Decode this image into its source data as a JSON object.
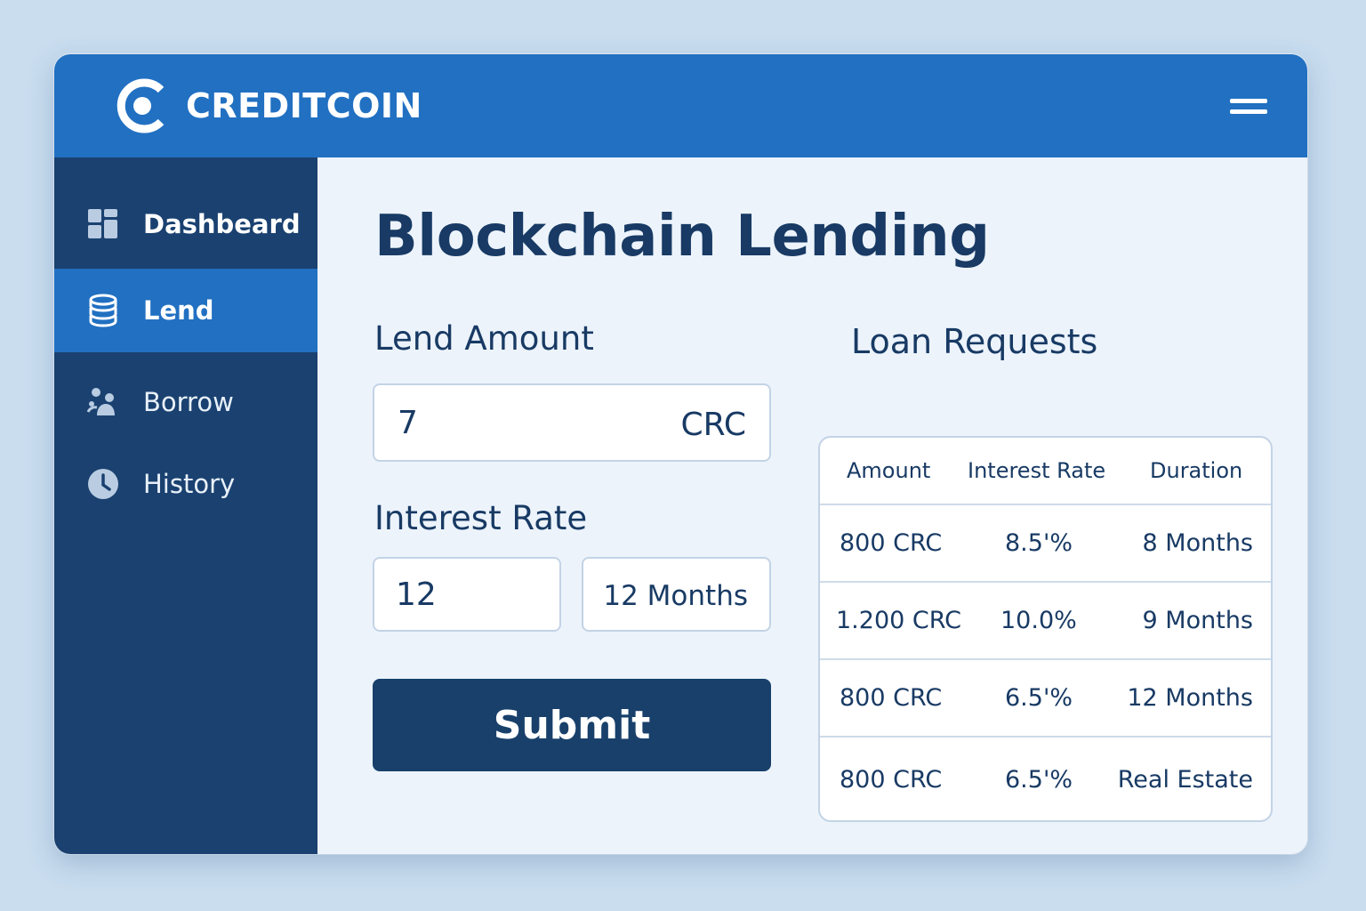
{
  "brand": {
    "name": "CREDITCOIN",
    "icon": "creditcoin-logo"
  },
  "header": {
    "menu_icon": "hamburger-menu-icon"
  },
  "colors": {
    "header_blue": "#2170c2",
    "sidebar_navy": "#1a4170",
    "content_bg": "#ecf3fb",
    "text_dark": "#183a64",
    "button_navy": "#18406b"
  },
  "sidebar": {
    "items": [
      {
        "label": "Dashbeard",
        "icon": "dashboard-grid-icon",
        "active": false
      },
      {
        "label": "Lend",
        "icon": "coin-stack-icon",
        "active": true
      },
      {
        "label": "Borrow",
        "icon": "people-icon",
        "active": false
      },
      {
        "label": "History",
        "icon": "clock-icon",
        "active": false
      }
    ]
  },
  "main": {
    "title": "Blockchain Lending",
    "lend_amount": {
      "label": "Lend Amount",
      "value": "7",
      "unit": "CRC"
    },
    "interest_rate": {
      "label": "Interest Rate",
      "value": "12",
      "duration": "12 Months"
    },
    "submit_label": "Submit"
  },
  "loan_requests": {
    "title": "Loan Requests",
    "columns": [
      "Amount",
      "Interest Rate",
      "Duration"
    ],
    "rows": [
      [
        "800 CRC",
        "8.5'%",
        "8 Months"
      ],
      [
        "1.200 CRC",
        "10.0%",
        "9 Months"
      ],
      [
        "800 CRC",
        "6.5'%",
        "12 Months"
      ],
      [
        "800 CRC",
        "6.5'%",
        "Real Estate"
      ]
    ]
  }
}
